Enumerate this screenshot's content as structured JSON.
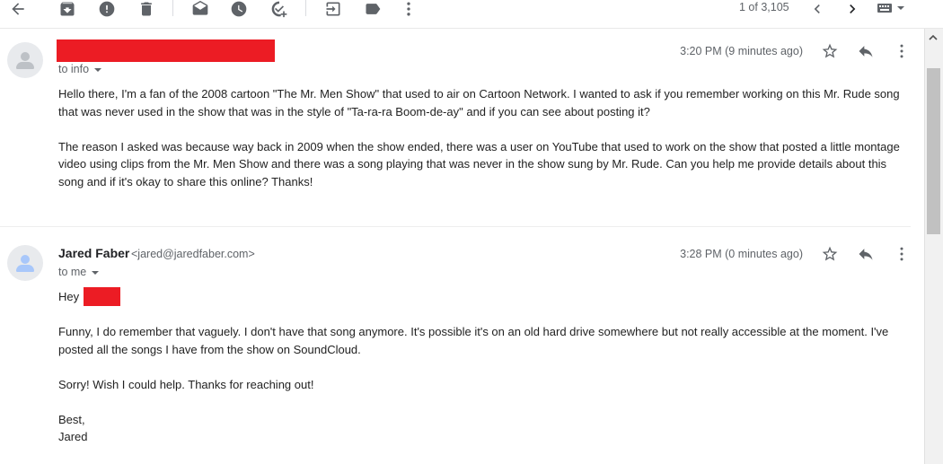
{
  "toolbar": {
    "icons": [
      "back-arrow-icon",
      "archive-icon",
      "report-spam-icon",
      "delete-icon",
      "mark-unread-icon",
      "snooze-icon",
      "add-to-tasks-icon",
      "move-to-icon",
      "labels-icon",
      "more-vert-icon"
    ],
    "pager_text": "1 of 3,105",
    "input_tool_icon": "keyboard-icon"
  },
  "messages": [
    {
      "sender_name": "",
      "sender_redacted": true,
      "recipient": "to info",
      "timestamp": "3:20 PM (9 minutes ago)",
      "paragraphs": [
        "Hello there, I'm a fan of the 2008 cartoon \"The Mr. Men Show\" that used to air on Cartoon Network. I wanted to ask if you remember working on this Mr. Rude song that was never used in the show that was in the style of \"Ta-ra-ra Boom-de-ay\" and if you can see about posting it?",
        "The reason I asked was because way back in 2009 when the show ended, there was a user on YouTube that used to work on the show that posted a little montage video using clips from the Mr. Men Show and there was a song playing that was never in the show sung by Mr. Rude. Can you help me provide details about this song and if it's okay to share this online? Thanks!"
      ]
    },
    {
      "sender_name": "Jared Faber",
      "sender_email": "<jared@jaredfaber.com>",
      "recipient": "to me",
      "timestamp": "3:28 PM (0 minutes ago)",
      "greeting": "Hey",
      "paragraphs": [
        "Funny, I do remember that vaguely. I don't have that song anymore. It's possible it's on an old hard drive somewhere but not really accessible at the moment. I've posted all the songs I have from the show on SoundCloud.",
        "Sorry! Wish I could help. Thanks for reaching out!",
        "Best,",
        "Jared"
      ]
    }
  ],
  "colors": {
    "redaction": "#ec1c24",
    "icon": "#5f6368",
    "text": "#222222"
  }
}
